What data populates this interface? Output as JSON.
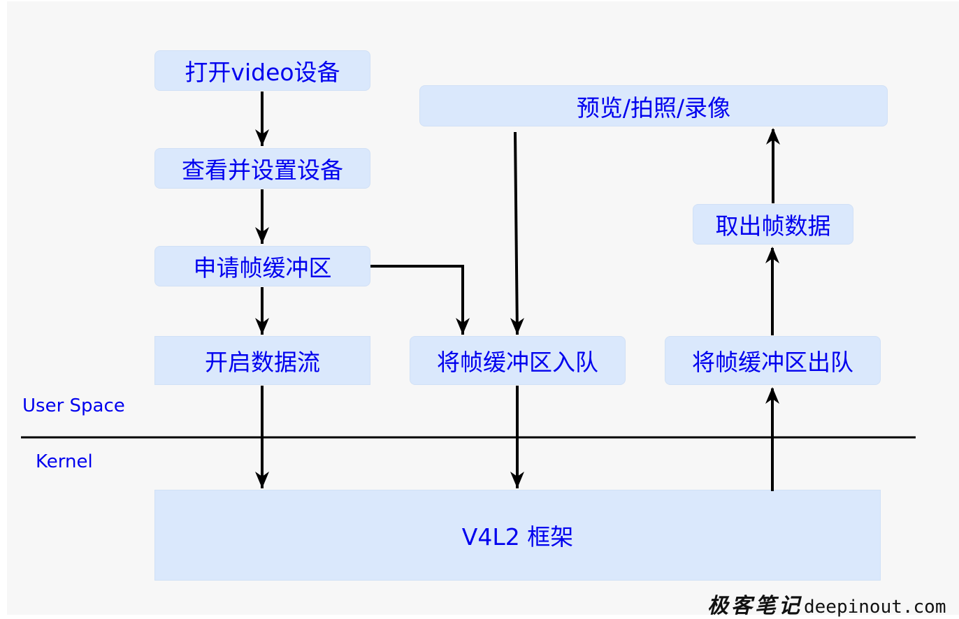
{
  "diagram": {
    "colors": {
      "box_fill": "#dae8fc",
      "text": "#0000ee",
      "arrow": "#000000",
      "background": "#f7f7f7"
    },
    "nodes": {
      "open_device": "打开video设备",
      "query_set_device": "查看并设置设备",
      "request_buffers": "申请帧缓冲区",
      "stream_on": "开启数据流",
      "queue_buffer": "将帧缓冲区入队",
      "dequeue_buffer": "将帧缓冲区出队",
      "fetch_frame": "取出帧数据",
      "preview_capture_record": "预览/拍照/录像",
      "v4l2_framework": "V4L2 框架"
    },
    "regions": {
      "user_space": "User Space",
      "kernel": "Kernel"
    },
    "edges": [
      {
        "from": "open_device",
        "to": "query_set_device"
      },
      {
        "from": "query_set_device",
        "to": "request_buffers"
      },
      {
        "from": "request_buffers",
        "to": "stream_on"
      },
      {
        "from": "request_buffers",
        "to": "queue_buffer"
      },
      {
        "from": "preview_capture_record",
        "to": "queue_buffer"
      },
      {
        "from": "stream_on",
        "to": "v4l2_framework"
      },
      {
        "from": "queue_buffer",
        "to": "v4l2_framework"
      },
      {
        "from": "v4l2_framework",
        "to": "dequeue_buffer"
      },
      {
        "from": "dequeue_buffer",
        "to": "fetch_frame"
      },
      {
        "from": "fetch_frame",
        "to": "preview_capture_record"
      }
    ]
  },
  "watermark": {
    "brand_cn": "极客笔记",
    "domain": "deepinout.com"
  }
}
